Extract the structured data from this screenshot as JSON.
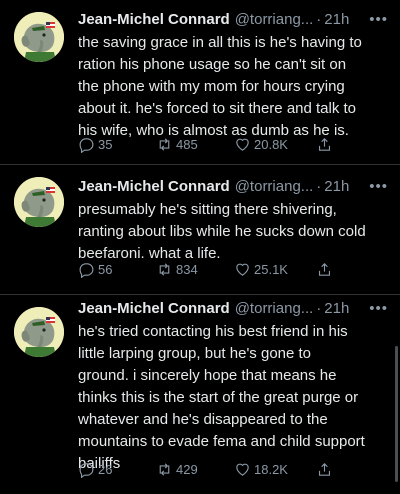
{
  "tweets": [
    {
      "name": "Jean-Michel Connard",
      "handle": "@torriang...",
      "sep": "·",
      "time": "21h",
      "more": "•••",
      "text": "the saving grace in all this is he's having to\nration his phone usage so he can't sit on\nthe phone with my mom for hours crying\nabout it. he's forced to sit there and talk to\nhis wife, who is almost as dumb as he is.",
      "replies": "35",
      "retweets": "485",
      "likes": "20.8K"
    },
    {
      "name": "Jean-Michel Connard",
      "handle": "@torriang...",
      "sep": "·",
      "time": "21h",
      "more": "•••",
      "text": "presumably he's sitting there shivering,\nranting about libs while he sucks down cold\nbeefaroni. what a life.",
      "replies": "56",
      "retweets": "834",
      "likes": "25.1K"
    },
    {
      "name": "Jean-Michel Connard",
      "handle": "@torriang...",
      "sep": "·",
      "time": "21h",
      "more": "•••",
      "text": "he's tried contacting his best friend in his\nlittle larping group, but he's gone to\nground. i sincerely hope that means he\nthinks this is the start of the great purge or\nwhatever and he's disappeared to the\nmountains to evade fema and child support\nbailiffs",
      "replies": "26",
      "retweets": "429",
      "likes": "18.2K"
    }
  ],
  "icons": {
    "reply": "reply-icon",
    "retweet": "retweet-icon",
    "like": "heart-icon",
    "share": "share-icon",
    "avatar": "elephant-avatar"
  },
  "colors": {
    "background": "#000000",
    "text": "#e7e9ea",
    "muted": "#8b98a5",
    "divider": "#2f3336"
  }
}
